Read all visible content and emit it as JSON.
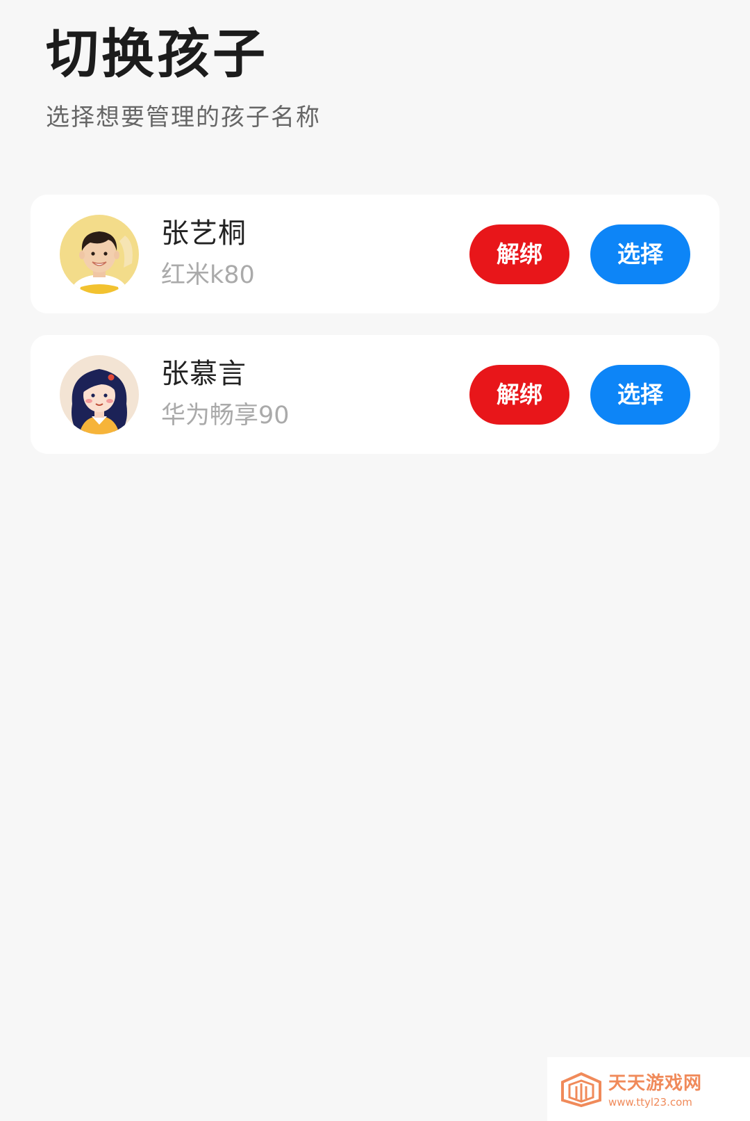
{
  "header": {
    "title": "切换孩子",
    "subtitle": "选择想要管理的孩子名称"
  },
  "children": [
    {
      "name": "张艺桐",
      "device": "红米k80",
      "avatar_icon": "boy-avatar-icon",
      "unbind_label": "解绑",
      "select_label": "选择"
    },
    {
      "name": "张慕言",
      "device": "华为畅享90",
      "avatar_icon": "girl-avatar-icon",
      "unbind_label": "解绑",
      "select_label": "选择"
    }
  ],
  "watermark": {
    "name": "天天游戏网",
    "url": "www.ttyl23.com"
  },
  "colors": {
    "background": "#f7f7f7",
    "card": "#ffffff",
    "unbind": "#e8161a",
    "select": "#0d85f7",
    "watermark": "#f08a5a"
  }
}
